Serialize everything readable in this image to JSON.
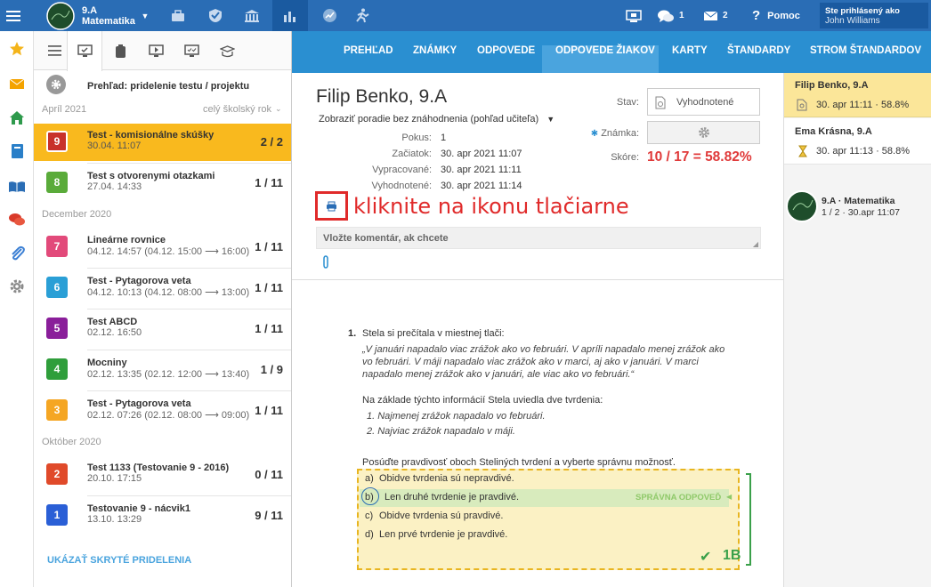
{
  "topbar": {
    "class_name": "9.A",
    "subject": "Matematika",
    "messages_count": "1",
    "mail_count": "2",
    "help_label": "Pomoc",
    "logged_label": "Ste prihlásený ako",
    "user_name": "John Williams"
  },
  "sidebar": {
    "tabs": [
      "menu-icon",
      "tests-icon",
      "homework-icon",
      "video-icon",
      "quiz-icon",
      "book-icon"
    ],
    "header_title": "Prehľad: pridelenie testu / projektu",
    "filter_label": "celý školský rok",
    "groups": [
      {
        "month": "Apríl 2021",
        "items": [
          {
            "num": "9",
            "title": "Test - komisionálne skúšky",
            "date": "30.04. 11:07",
            "count": "2 / 2",
            "color": "#c8312b",
            "active": true
          },
          {
            "num": "8",
            "title": "Test s otvorenymi otazkami",
            "date": "27.04. 14:33",
            "count": "1 / 11",
            "color": "#5aab3a"
          }
        ]
      },
      {
        "month": "December 2020",
        "items": [
          {
            "num": "7",
            "title": "Lineárne rovnice",
            "date": "04.12. 14:57 (04.12. 15:00 ⟶ 16:00)",
            "count": "1 / 11",
            "color": "#e24a7a"
          },
          {
            "num": "6",
            "title": "Test - Pytagorova veta",
            "date": "04.12. 10:13 (04.12. 08:00 ⟶ 13:00)",
            "count": "1 / 11",
            "color": "#2a9fd6"
          },
          {
            "num": "5",
            "title": "Test ABCD",
            "date": "02.12. 16:50",
            "count": "1 / 11",
            "color": "#8a1e9a"
          },
          {
            "num": "4",
            "title": "Mocniny",
            "date": "02.12. 13:35 (02.12. 12:00 ⟶ 13:40)",
            "count": "1 / 9",
            "color": "#2f9e3b"
          },
          {
            "num": "3",
            "title": "Test - Pytagorova veta",
            "date": "02.12. 07:26 (02.12. 08:00 ⟶ 09:00)",
            "count": "1 / 11",
            "color": "#f5a623"
          }
        ]
      },
      {
        "month": "Október 2020",
        "items": [
          {
            "num": "2",
            "title": "Test 1133 (Testovanie 9 - 2016)",
            "date": "20.10. 17:15",
            "count": "0 / 11",
            "color": "#e04a2a"
          },
          {
            "num": "1",
            "title": "Testovanie 9 - nácvik1",
            "date": "13.10. 13:29",
            "count": "9 / 11",
            "color": "#2a5fd6"
          }
        ]
      }
    ],
    "show_hidden": "UKÁZAŤ SKRYTÉ PRIDELENIA"
  },
  "nav": {
    "tabs": [
      "PREHĽAD",
      "ZNÁMKY",
      "ODPOVEDE",
      "ODPOVEDE ŽIAKOV",
      "KARTY",
      "ŠTANDARDY",
      "STROM ŠTANDARDOV"
    ],
    "active": "ODPOVEDE ŽIAKOV"
  },
  "student": {
    "name": "Filip Benko, 9.A",
    "order_toggle": "Zobraziť poradie bez znáhodnenia (pohľad učiteľa)",
    "pokus_label": "Pokus:",
    "pokus": "1",
    "zaciatok_label": "Začiatok:",
    "zaciatok": "30. apr 2021 11:07",
    "vypracovane_label": "Vypracované:",
    "vypracovane": "30. apr 2021 11:11",
    "vyhodnotene_label": "Vyhodnotené:",
    "vyhodnotene": "30. apr 2021 11:14",
    "stav_label": "Stav:",
    "stav": "Vyhodnotené",
    "znamka_label": "Známka:",
    "skore_label": "Skóre:",
    "skore": "10 / 17 = 58.82%",
    "print_hint": "kliknite na ikonu tlačiarne",
    "comment_placeholder": "Vložte komentár, ak chcete"
  },
  "question": {
    "number": "1.",
    "intro": "Stela si prečítala v miestnej tlači:",
    "quote": "„V januári napadalo viac zrážok ako vo februári. V apríli napadalo menej zrážok ako vo februári. V máji napadalo viac zrážok ako v marci, aj ako v januári. V marci napadalo menej zrážok ako v januári, ale viac ako vo februári.“",
    "claims_intro": "Na základe týchto informácií Stela uviedla dve tvrdenia:",
    "claims": [
      "1. Najmenej zrážok napadalo vo februári.",
      "2. Najviac zrážok napadalo v máji."
    ],
    "task": "Posúďte pravdivosť oboch Steliných tvrdení a vyberte správnu možnosť.",
    "options": [
      {
        "letter": "a)",
        "text": "Obidve tvrdenia sú nepravdivé."
      },
      {
        "letter": "b)",
        "text": "Len druhé tvrdenie je pravdivé.",
        "correct": true
      },
      {
        "letter": "c)",
        "text": "Obidve tvrdenia sú pravdivé."
      },
      {
        "letter": "d)",
        "text": "Len prvé tvrdenie je pravdivé."
      }
    ],
    "correct_label": "SPRÁVNA ODPOVEĎ",
    "points": "1B"
  },
  "right": {
    "students": [
      {
        "name": "Filip Benko, 9.A",
        "info": "30. apr 11:11 · 58.8%",
        "active": true
      },
      {
        "name": "Ema Krásna, 9.A",
        "info": "30. apr 11:13 · 58.8%"
      }
    ],
    "class_title": "9.A · Matematika",
    "class_sub": "1 / 2 · 30.apr 11:07"
  }
}
